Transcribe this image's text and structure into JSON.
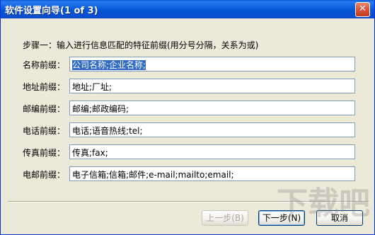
{
  "window": {
    "title": "软件设置向导(1 of 3)",
    "close_glyph": "✕"
  },
  "prompt": "步骤一：输入进行信息匹配的特征前缀(用分号分隔，关系为或)",
  "fields": [
    {
      "label": "名称前缀：",
      "value": "公司名称;企业名称;",
      "selected": true
    },
    {
      "label": "地址前缀：",
      "value": "地址;厂址;"
    },
    {
      "label": "邮编前缀：",
      "value": "邮编;邮政编码;"
    },
    {
      "label": "电话前缀：",
      "value": "电话;语音热线;tel;"
    },
    {
      "label": "传真前缀：",
      "value": "传真;fax;"
    },
    {
      "label": "电邮前缀：",
      "value": "电子信箱;信箱;邮件;e-mail;mailto;email;"
    }
  ],
  "buttons": {
    "back": "上一步(B)",
    "next": "下一步(N)",
    "cancel": "取消"
  },
  "watermark": "下载吧",
  "colors": {
    "titlebar": "#0a5ad9",
    "selection": "#316ac5",
    "background": "#ece9d8"
  }
}
